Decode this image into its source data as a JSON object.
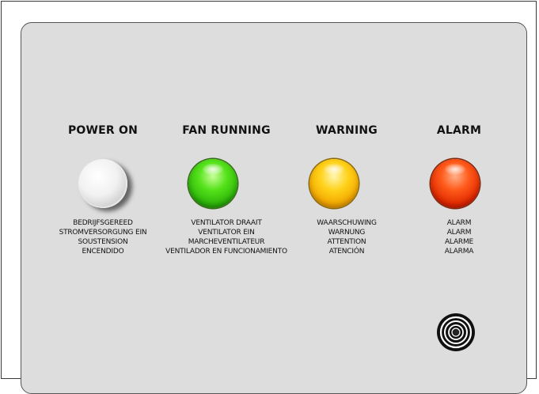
{
  "indicators": [
    {
      "title": "POWER ON",
      "color": "#f0f0f0",
      "icon": "white-indicator-lamp",
      "lines": [
        "BEDRIJFSGEREED",
        "STROMVERSORGUNG EIN",
        "SOUSTENSION",
        "ENCENDIDO"
      ]
    },
    {
      "title": "FAN RUNNING",
      "color": "#3ccf12",
      "icon": "green-indicator-lamp",
      "lines": [
        "VENTILATOR DRAAIT",
        "VENTILATOR EIN",
        "MARCHEVENTILATEUR",
        "VENTILADOR EN FUNCIONAMIENTO"
      ]
    },
    {
      "title": "WARNING",
      "color": "#ffc20e",
      "icon": "amber-indicator-lamp",
      "lines": [
        "WAARSCHUWING",
        "WARNUNG",
        "ATTENTION",
        "ATENCIÓN"
      ]
    },
    {
      "title": "ALARM",
      "color": "#f03a0a",
      "icon": "red-indicator-lamp",
      "lines": [
        "ALARM",
        "ALARM",
        "ALARME",
        "ALARMA"
      ]
    }
  ],
  "buzzer": {
    "icon": "buzzer-speaker-icon"
  }
}
